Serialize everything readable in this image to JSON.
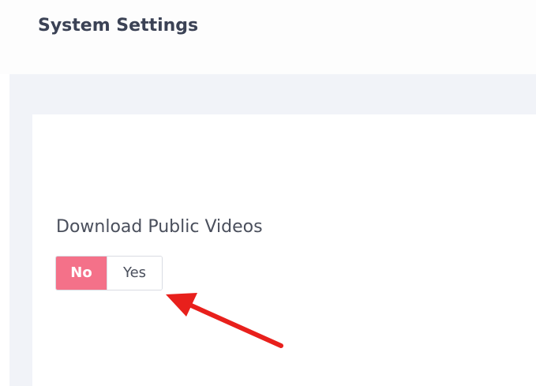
{
  "header": {
    "title": "System Settings"
  },
  "settings": {
    "download_public_videos": {
      "label": "Download Public Videos",
      "options": [
        "No",
        "Yes"
      ],
      "selected": "No"
    }
  },
  "colors": {
    "selected_toggle": "#f47189",
    "page_background": "#f1f3f8",
    "annotation_arrow": "#e8201c"
  }
}
